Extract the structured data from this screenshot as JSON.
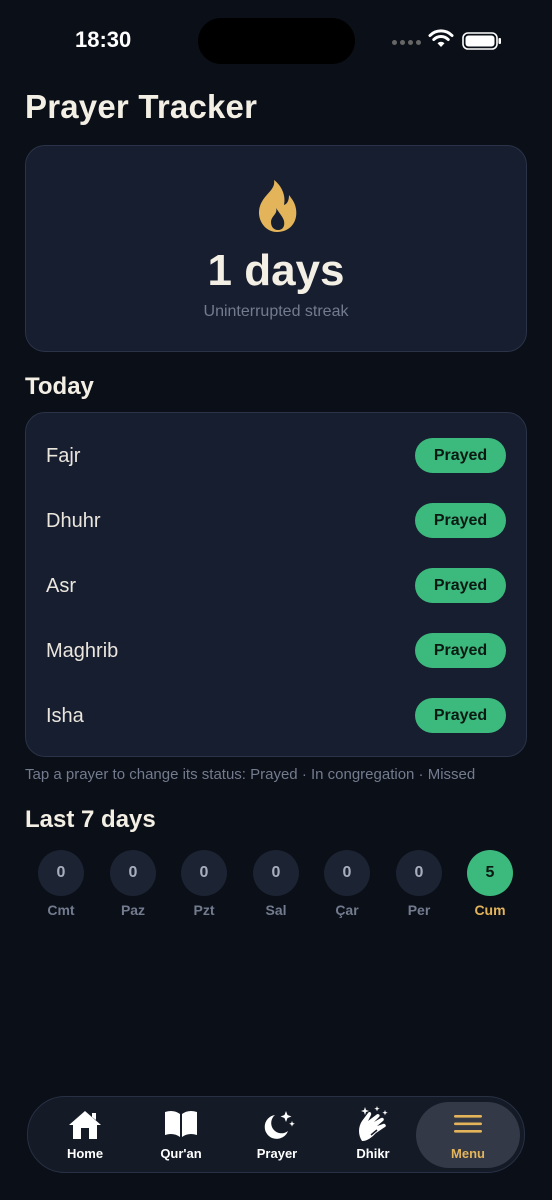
{
  "status_bar": {
    "time": "18:30"
  },
  "title": "Prayer Tracker",
  "streak": {
    "value": "1 days",
    "label": "Uninterrupted streak"
  },
  "today": {
    "heading": "Today",
    "prayers": [
      {
        "name": "Fajr",
        "status": "Prayed"
      },
      {
        "name": "Dhuhr",
        "status": "Prayed"
      },
      {
        "name": "Asr",
        "status": "Prayed"
      },
      {
        "name": "Maghrib",
        "status": "Prayed"
      },
      {
        "name": "Isha",
        "status": "Prayed"
      }
    ],
    "hint": "Tap a prayer to change its status: Prayed · In congregation · Missed"
  },
  "week": {
    "heading": "Last 7 days",
    "days": [
      {
        "label": "Cmt",
        "count": "0"
      },
      {
        "label": "Paz",
        "count": "0"
      },
      {
        "label": "Pzt",
        "count": "0"
      },
      {
        "label": "Sal",
        "count": "0"
      },
      {
        "label": "Çar",
        "count": "0"
      },
      {
        "label": "Per",
        "count": "0"
      },
      {
        "label": "Cum",
        "count": "5"
      }
    ]
  },
  "tabs": [
    {
      "label": "Home",
      "icon": "house-icon"
    },
    {
      "label": "Qur'an",
      "icon": "book-icon"
    },
    {
      "label": "Prayer",
      "icon": "moon-stars-icon"
    },
    {
      "label": "Dhikr",
      "icon": "hands-sparkle-icon"
    },
    {
      "label": "Menu",
      "icon": "hamburger-icon"
    }
  ],
  "colors": {
    "accent": "#e4b45a",
    "success": "#3cb97d",
    "background": "#0b0f17",
    "card": "#171e2f"
  }
}
